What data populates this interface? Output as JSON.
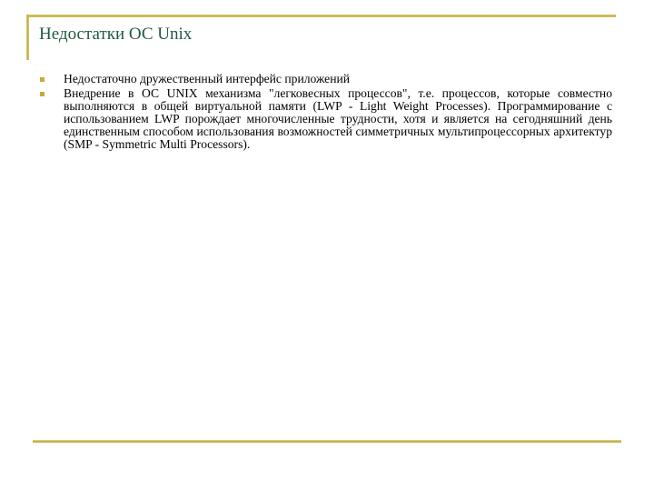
{
  "slide": {
    "title": "Недостатки ОС Unix",
    "bullets": [
      {
        "text": "Недостаточно дружественный интерфейс приложений"
      },
      {
        "text": "Внедрение в ОС UNIX механизма \"легковесных процессов\", т.е. процессов, которые совместно выполняются в общей виртуальной памяти (LWP - Light Weight Processes). Программирование с использованием LWP порождает многочисленные трудности, хотя и является на сегодняшний день единственным способом использования возможностей симметричных мультипроцессорных архитектур (SMP - Symmetric Multi Processors)."
      }
    ],
    "colors": {
      "title": "#1f5a3f",
      "rule": "#b9a646",
      "bullet": "#c7ab3a"
    }
  }
}
